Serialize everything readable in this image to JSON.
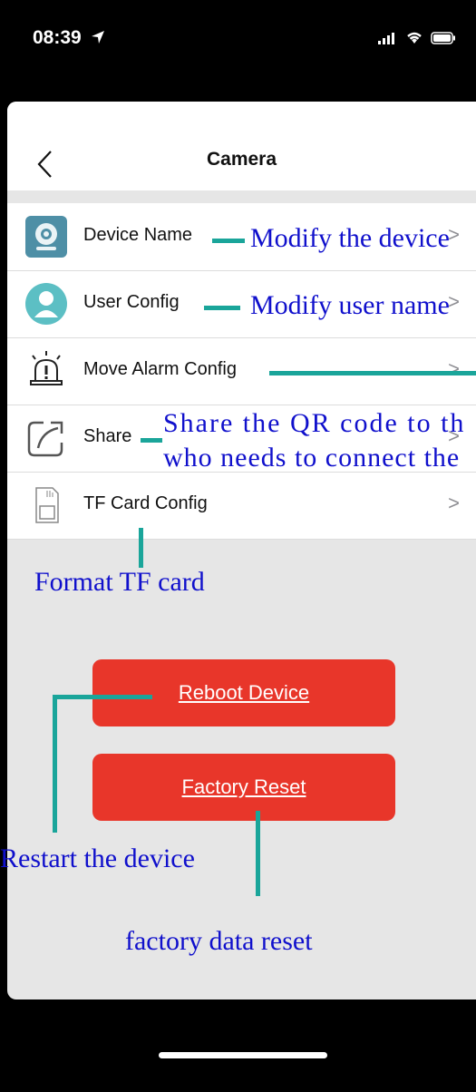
{
  "status_bar": {
    "time": "08:39"
  },
  "header": {
    "title": "Camera"
  },
  "settings": [
    {
      "label": "Device Name",
      "icon": "camera-icon"
    },
    {
      "label": "User Config",
      "icon": "user-icon"
    },
    {
      "label": "Move Alarm Config",
      "icon": "alarm-icon"
    },
    {
      "label": "Share",
      "icon": "share-icon"
    },
    {
      "label": "TF Card Config",
      "icon": "sd-card-icon"
    }
  ],
  "buttons": {
    "reboot": "Reboot Device",
    "factory_reset": "Factory Reset"
  },
  "annotations": {
    "device_name": "Modify the device",
    "user_config": "Modify user name",
    "share_line1": "Share the QR code to th",
    "share_line2": "who needs to connect the",
    "tf_card": "Format TF card",
    "reboot": "Restart the device",
    "factory_reset": "factory data reset"
  },
  "colors": {
    "accent_red": "#e8362a",
    "annotation_blue": "#1010cc",
    "annotation_teal": "#1aa59a"
  }
}
